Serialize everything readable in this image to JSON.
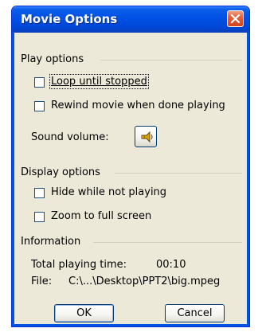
{
  "dialog": {
    "title": "Movie Options"
  },
  "play_options": {
    "group_label": "Play options",
    "loop_label": "Loop until stopped",
    "rewind_label": "Rewind movie when done playing",
    "volume_label": "Sound volume:",
    "volume_icon": "speaker-icon"
  },
  "display_options": {
    "group_label": "Display options",
    "hide_label": "Hide while not playing",
    "zoom_label": "Zoom to full screen"
  },
  "information": {
    "group_label": "Information",
    "total_time_label": "Total playing time:",
    "total_time_value": "00:10",
    "file_label": "File:",
    "file_value": "C:\\...\\Desktop\\PPT2\\big.mpeg"
  },
  "buttons": {
    "ok": "OK",
    "cancel": "Cancel"
  },
  "colors": {
    "titlebar": "#0050e6",
    "dialog_bg": "#ece9d8",
    "close_button": "#d2451d"
  }
}
